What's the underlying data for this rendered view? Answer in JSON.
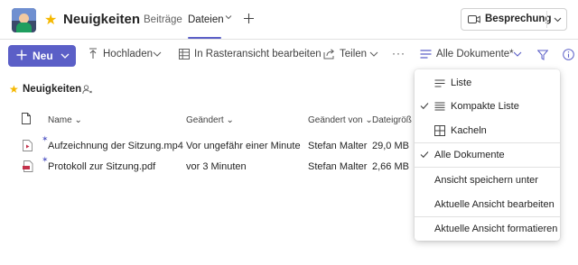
{
  "header": {
    "site_title": "Neuigkeiten",
    "tabs": [
      {
        "label": "Beiträge"
      },
      {
        "label": "Dateien"
      }
    ],
    "meet_label": "Besprechung"
  },
  "toolbar": {
    "new_label": "Neu",
    "upload_label": "Hochladen",
    "grid_label": "In Rasteransicht bearbeiten",
    "share_label": "Teilen",
    "more_label": "···",
    "view_label": "Alle Dokumente*"
  },
  "library": {
    "title": "Neuigkeiten",
    "columns": {
      "name": "Name",
      "modified": "Geändert",
      "modified_by": "Geändert von",
      "size": "Dateigröße"
    },
    "files": [
      {
        "name": "Aufzeichnung der Sitzung.mp4",
        "modified": "Vor ungefähr einer Minute",
        "modified_by": "Stefan Malter",
        "size": "29,0 MB",
        "icon": "video-file-icon"
      },
      {
        "name": "Protokoll zur Sitzung.pdf",
        "modified": "vor 3 Minuten",
        "modified_by": "Stefan Malter",
        "size": "2,66 MB",
        "icon": "pdf-file-icon"
      }
    ]
  },
  "view_menu": {
    "items": [
      {
        "label": "Liste",
        "icon": "list-icon",
        "checked": false
      },
      {
        "label": "Kompakte Liste",
        "icon": "compact-list-icon",
        "checked": true
      },
      {
        "label": "Kacheln",
        "icon": "tiles-icon",
        "checked": false
      },
      {
        "label": "Alle Dokumente",
        "checked": true
      },
      {
        "label": "Ansicht speichern unter"
      },
      {
        "label": "Aktuelle Ansicht bearbeiten"
      },
      {
        "label": "Aktuelle Ansicht formatieren"
      }
    ]
  },
  "colors": {
    "accent": "#5b5fc7",
    "star": "#f5b800",
    "pdf_red": "#c4314b"
  }
}
